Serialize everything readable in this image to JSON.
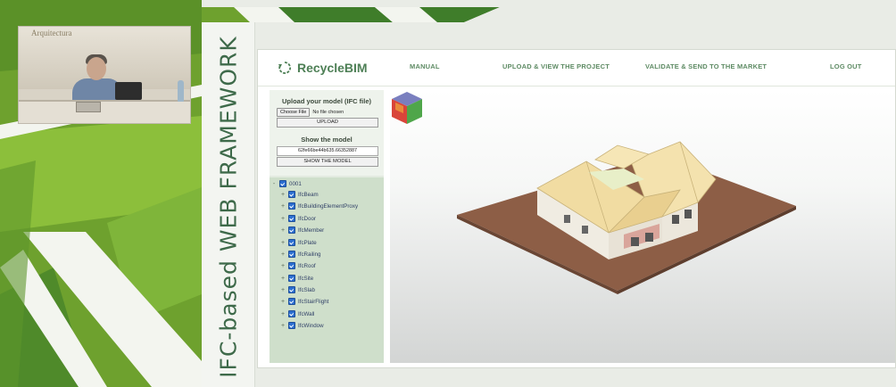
{
  "slide": {
    "vertical_title": "IFC-based WEB FRAMEWORK",
    "colors": {
      "green_dark": "#3f7d2a",
      "green_light": "#8fbf3a",
      "title": "#3e6a4a"
    }
  },
  "video_inset": {
    "plaque_text": "Arquitectura"
  },
  "app": {
    "logo_text": "RecycleBIM",
    "nav": [
      "MANUAL",
      "UPLOAD & VIEW THE PROJECT",
      "VALIDATE & SEND TO THE MARKET",
      "LOG OUT"
    ],
    "upload_section": {
      "heading": "Upload your model (IFC file)",
      "choose_file_label": "Choose File",
      "file_status": "No file chosen",
      "upload_button": "UPLOAD"
    },
    "show_section": {
      "heading": "Show the model",
      "model_id_value": "62fe66be44b635.66352887",
      "show_button": "SHOW THE MODEL"
    },
    "tree": {
      "root": "0001",
      "items": [
        "IfcBeam",
        "IfcBuildingElementProxy",
        "IfcDoor",
        "IfcMember",
        "IfcPlate",
        "IfcRailing",
        "IfcRoof",
        "IfcSite",
        "IfcSlab",
        "IfcStairFlight",
        "IfcWall",
        "IfcWindow"
      ]
    },
    "colors": {
      "accent": "#4d7f55",
      "tree_bg": "#cfdfcb",
      "site": "#8d5e46",
      "roof": "#f1dca2",
      "walls": "#f0ece2",
      "accent_wall": "#d9a59b"
    }
  }
}
